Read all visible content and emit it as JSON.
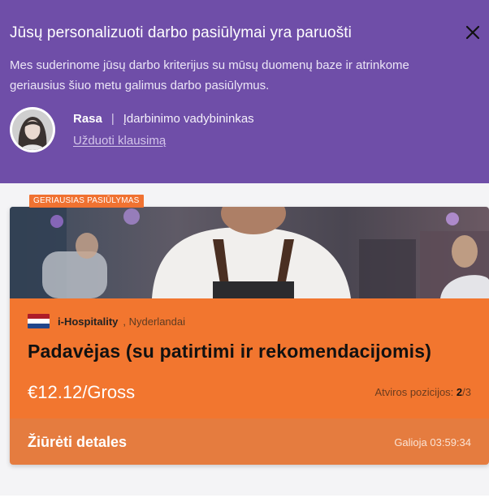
{
  "header": {
    "title": "Jūsų personalizuoti darbo pasiūlymai yra paruošti",
    "description": "Mes suderinome jūsų darbo kriterijus su mūsų duomenų baze ir atrinkome geriausius šiuo metu galimus darbo pasiūlymus.",
    "agent": {
      "name": "Rasa",
      "separator": "|",
      "role": "Įdarbinimo vadybininkas",
      "ask_link": "Užduoti klausimą"
    },
    "colors": {
      "background": "#6f4ea8"
    }
  },
  "offer": {
    "badge": "GERIAUSIAS PASIŪLYMAS",
    "company": "i-Hospitality",
    "location": ", Nyderlandai",
    "title": "Padavėjas (su patirtimi ir rekomendacijomis)",
    "salary": "€12.12/Gross",
    "positions_label": "Atviros pozicijos:",
    "positions_open": "2",
    "positions_total": "/3",
    "details_button": "Žiūrėti detales",
    "validity": "Galioja 03:59:34",
    "flag_icon": "netherlands-flag-icon",
    "colors": {
      "card": "#f2762f",
      "footer": "#e57c3f",
      "badge": "#f07231"
    }
  }
}
